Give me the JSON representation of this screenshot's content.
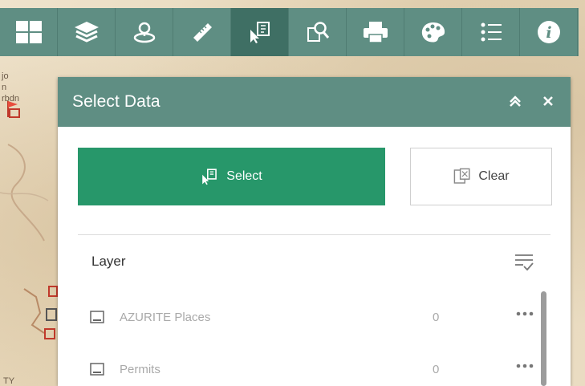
{
  "toolbar": {
    "tools": [
      {
        "icon": "widget-grid-icon"
      },
      {
        "icon": "layers-icon"
      },
      {
        "icon": "location-pin-icon"
      },
      {
        "icon": "measure-ruler-icon"
      },
      {
        "icon": "select-data-icon",
        "active": true
      },
      {
        "icon": "query-icon"
      },
      {
        "icon": "print-icon"
      },
      {
        "icon": "basemap-palette-icon"
      },
      {
        "icon": "legend-list-icon"
      },
      {
        "icon": "info-icon"
      }
    ]
  },
  "map": {
    "labels": [
      "jo",
      "n",
      "rbdn",
      "TY"
    ]
  },
  "panel": {
    "title": "Select Data",
    "select_label": "Select",
    "clear_label": "Clear",
    "layer_heading": "Layer",
    "layers": [
      {
        "name": "AZURITE Places",
        "count": "0"
      },
      {
        "name": "Permits",
        "count": "0"
      }
    ]
  },
  "colors": {
    "toolbar": "#5f8e83",
    "toolbar_active": "#3f6f64",
    "select_button": "#27976a",
    "disabled_text": "#a9a9a9"
  }
}
